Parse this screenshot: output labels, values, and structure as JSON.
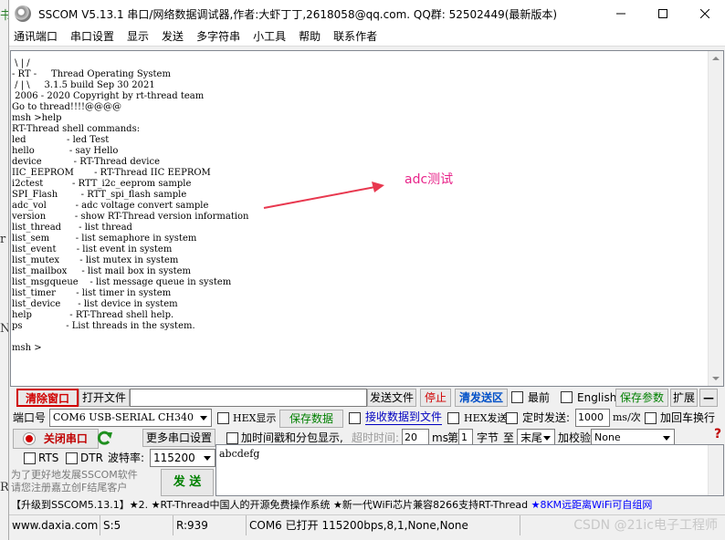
{
  "window": {
    "title": "SSCOM V5.13.1 串口/网络数据调试器,作者:大虾丁丁,2618058@qq.com. QQ群: 52502449(最新版本)"
  },
  "background_fragments": [
    "书",
    "r",
    "Ns",
    "Rt"
  ],
  "menu": [
    "通讯端口",
    "串口设置",
    "显示",
    "发送",
    "多字符串",
    "小工具",
    "帮助",
    "联系作者"
  ],
  "terminal": {
    "lines": [
      " \\ | /",
      "- RT -     Thread Operating System",
      " / | \\     3.1.5 build Sep 30 2021",
      " 2006 - 2020 Copyright by rt-thread team",
      "Go to thread!!!!@@@@",
      "msh >help",
      "RT-Thread shell commands:",
      "led              - led Test",
      "hello            - say Hello",
      "device           - RT-Thread device",
      "IIC_EEPROM       - RT-Thread IIC EEPROM",
      "i2ctest          - RTT_i2c_eeprom sample",
      "SPI_Flash        - RTT_spi_flash sample",
      "adc_vol          - adc voltage convert sample",
      "version          - show RT-Thread version information",
      "list_thread      - list thread",
      "list_sem         - list semaphore in system",
      "list_event       - list event in system",
      "list_mutex       - list mutex in system",
      "list_mailbox     - list mail box in system",
      "list_msgqueue    - list message queue in system",
      "list_timer       - list timer in system",
      "list_device      - list device in system",
      "help             - RT-Thread shell help.",
      "ps               - List threads in the system.",
      "",
      "msh >"
    ],
    "annotation": "adc测试",
    "annotation_color": "#e8258a"
  },
  "toolbar1": {
    "clear_window": "清除窗口",
    "open_file": "打开文件",
    "file_path": "",
    "send_file": "发送文件",
    "stop": "停止",
    "clear_send": "清发送区",
    "frontmost": "最前",
    "english": "English",
    "save_params": "保存参数",
    "expand": "扩展",
    "collapse": "—"
  },
  "toolbar2": {
    "port_label": "端口号",
    "port_value": "COM6 USB-SERIAL CH340",
    "hex_display": "HEX显示",
    "save_data": "保存数据",
    "recv_to_file": "接收数据到文件",
    "hex_send": "HEX发送",
    "timed_send": "定时发送:",
    "interval": "1000",
    "interval_unit": "ms/次",
    "add_crlf": "加回车换行"
  },
  "toolbar3": {
    "close_port": "关闭串口",
    "more_settings": "更多串口设置",
    "timestamp": "加时间戳和分包显示,",
    "timeout_label": "超时时间:",
    "timeout_value": "20",
    "timeout_unit": "ms",
    "nth_label": "第",
    "nth_value": "1",
    "byte_label": "字节",
    "to_label": "至",
    "end_value": "末尾",
    "checksum_label": "加校验",
    "checksum_value": "None"
  },
  "toolbar4": {
    "rts": "RTS",
    "dtr": "DTR",
    "baud_label": "波特率:",
    "baud_value": "115200"
  },
  "left_info": {
    "line1": "为了更好地发展SSCOM软件",
    "line2": "请您注册嘉立创F结尾客户",
    "send_button": "发 送"
  },
  "send_area": {
    "content": "abcdefg"
  },
  "promo": {
    "part1": "【升级到SSCOM5.13.1】★2. ★RT-Thread中国人的开源免费操作系统 ★新一代WiFi芯片兼容8266支持RT-Thread ",
    "part2": "★8KM远距离WiFi可自组网"
  },
  "status": {
    "website": "www.daxia.com",
    "sent": "S:5",
    "received": "R:939",
    "port_status": "COM6 已打开  115200bps,8,1,None,None",
    "watermark": "CSDN @21ic电子工程师"
  }
}
